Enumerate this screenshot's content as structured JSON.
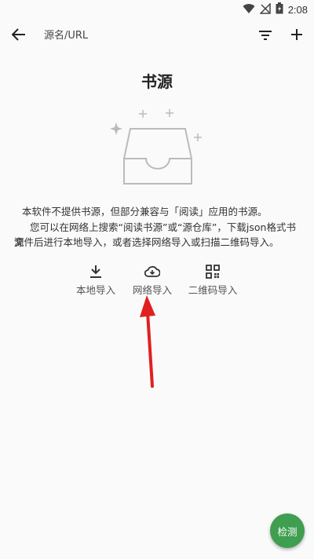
{
  "status_bar": {
    "time": "2:08",
    "icons": [
      "wifi-icon",
      "signal-off-icon",
      "battery-charging-icon"
    ]
  },
  "app_bar": {
    "back_icon": "arrow-left-icon",
    "search_placeholder": "源名/URL",
    "filter_icon": "filter-icon",
    "add_icon": "plus-icon"
  },
  "empty_state": {
    "title": "书源",
    "illustration_icon": "empty-inbox-icon",
    "description_lines": [
      "本软件不提供书源，但部分兼容与「阅读」应用的书源。",
      "您可以在网络上搜索“阅读书源”或“源仓库”，下载json格式书源",
      "文件后进行本地导入，或者选择网络导入或扫描二维码导入。"
    ]
  },
  "import_actions": [
    {
      "label": "本地导入",
      "icon": "download-icon"
    },
    {
      "label": "网络导入",
      "icon": "cloud-download-icon"
    },
    {
      "label": "二维码导入",
      "icon": "qr-code-icon"
    }
  ],
  "annotation": {
    "icon": "red-arrow-annotation",
    "color": "#e02020"
  },
  "fab": {
    "label": "检测",
    "color": "#3f9e4f"
  }
}
